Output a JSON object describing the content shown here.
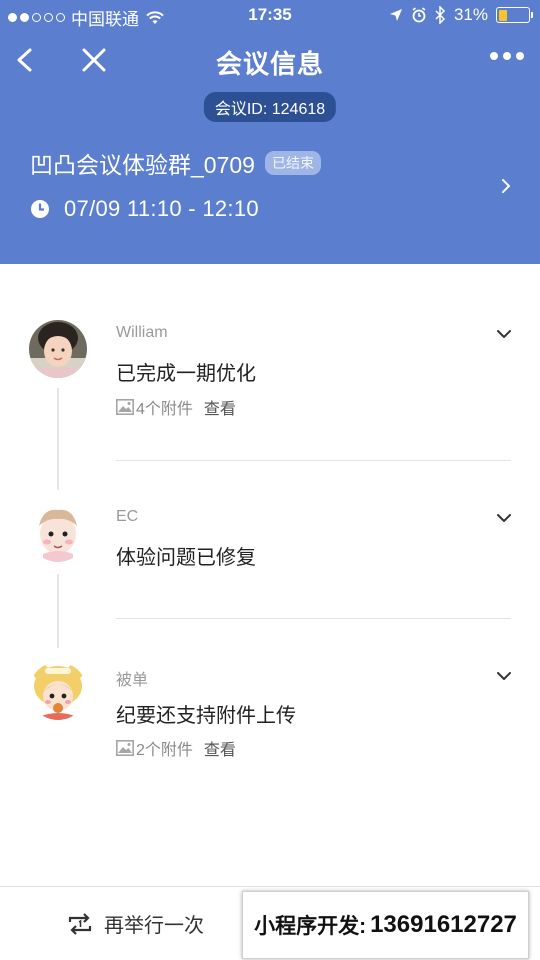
{
  "status_bar": {
    "carrier": "中国联通",
    "time": "17:35",
    "battery_percent": "31%",
    "battery_level": 0.31,
    "icons": [
      "signal-dots-icon",
      "wifi-icon",
      "location-icon",
      "alarm-icon",
      "bluetooth-icon",
      "battery-icon"
    ]
  },
  "header": {
    "title": "会议信息",
    "meeting_id": "会议ID: 124618",
    "meeting_name": "凹凸会议体验群_0709",
    "status_badge": "已结束",
    "time_range": "07/09 11:10 - 12:10",
    "bg_color": "#5b7ece"
  },
  "entries": [
    {
      "author": "William",
      "content": "已完成一期优化",
      "attachments": "4个附件",
      "view_label": "查看"
    },
    {
      "author": "EC",
      "content": "体验问题已修复"
    },
    {
      "author": "被单",
      "content": "纪要还支持附件上传",
      "attachments": "2个附件",
      "view_label": "查看"
    }
  ],
  "bottom": {
    "repeat_label": "再举行一次",
    "promo_label": "小程序开发:",
    "promo_number": "13691612727"
  }
}
